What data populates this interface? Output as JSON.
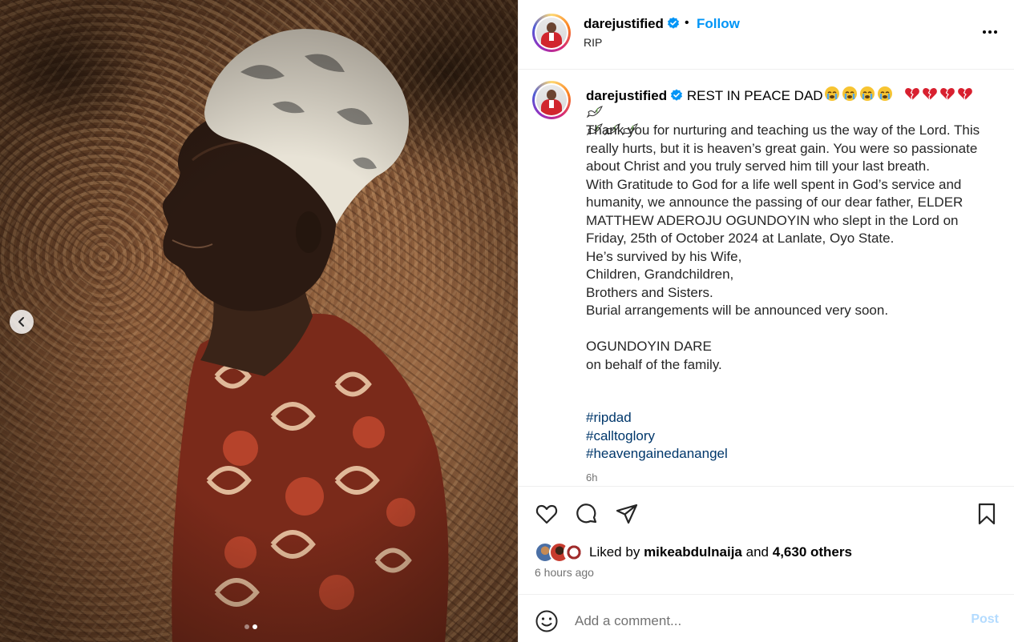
{
  "post": {
    "username": "darejustified",
    "follow_label": "Follow",
    "separator": "•",
    "subtitle": "RIP",
    "more_icon": "more-horizontal-icon"
  },
  "caption": {
    "username": "darejustified",
    "headline": "REST IN PEACE DAD",
    "body": "Thank you for nurturing and teaching us the way of the Lord. This really hurts, but it is heaven’s great gain. You were so passionate about Christ and you truly served him till your last breath.\nWith Gratitude to God for a life well spent in God’s service and humanity, we announce the passing of our dear father, ELDER MATTHEW ADEROJU OGUNDOYIN who slept in the Lord on Friday, 25th of October 2024 at Lanlate, Oyo State.\nHe’s survived by his Wife,\nChildren, Grandchildren,\nBrothers and Sisters.\nBurial arrangements will be announced very soon.\n\nOGUNDOYIN DARE\non behalf of the family.",
    "hashtags": [
      "#ripdad",
      "#calltoglory",
      "#heavengainedanangel"
    ],
    "time": "6h"
  },
  "actions": {
    "like_icon": "heart-icon",
    "comment_icon": "comment-icon",
    "share_icon": "share-icon",
    "save_icon": "bookmark-icon"
  },
  "likes": {
    "prefix": "Liked by",
    "first_user": "mikeabdulnaija",
    "connector": "and",
    "others": "4,630 others"
  },
  "timestamp": "6 hours ago",
  "comment": {
    "placeholder": "Add a comment...",
    "post_label": "Post"
  },
  "colors": {
    "accent": "#0095f6",
    "hashtag": "#00376b",
    "muted": "#737373",
    "post_disabled": "#b3dbff"
  }
}
